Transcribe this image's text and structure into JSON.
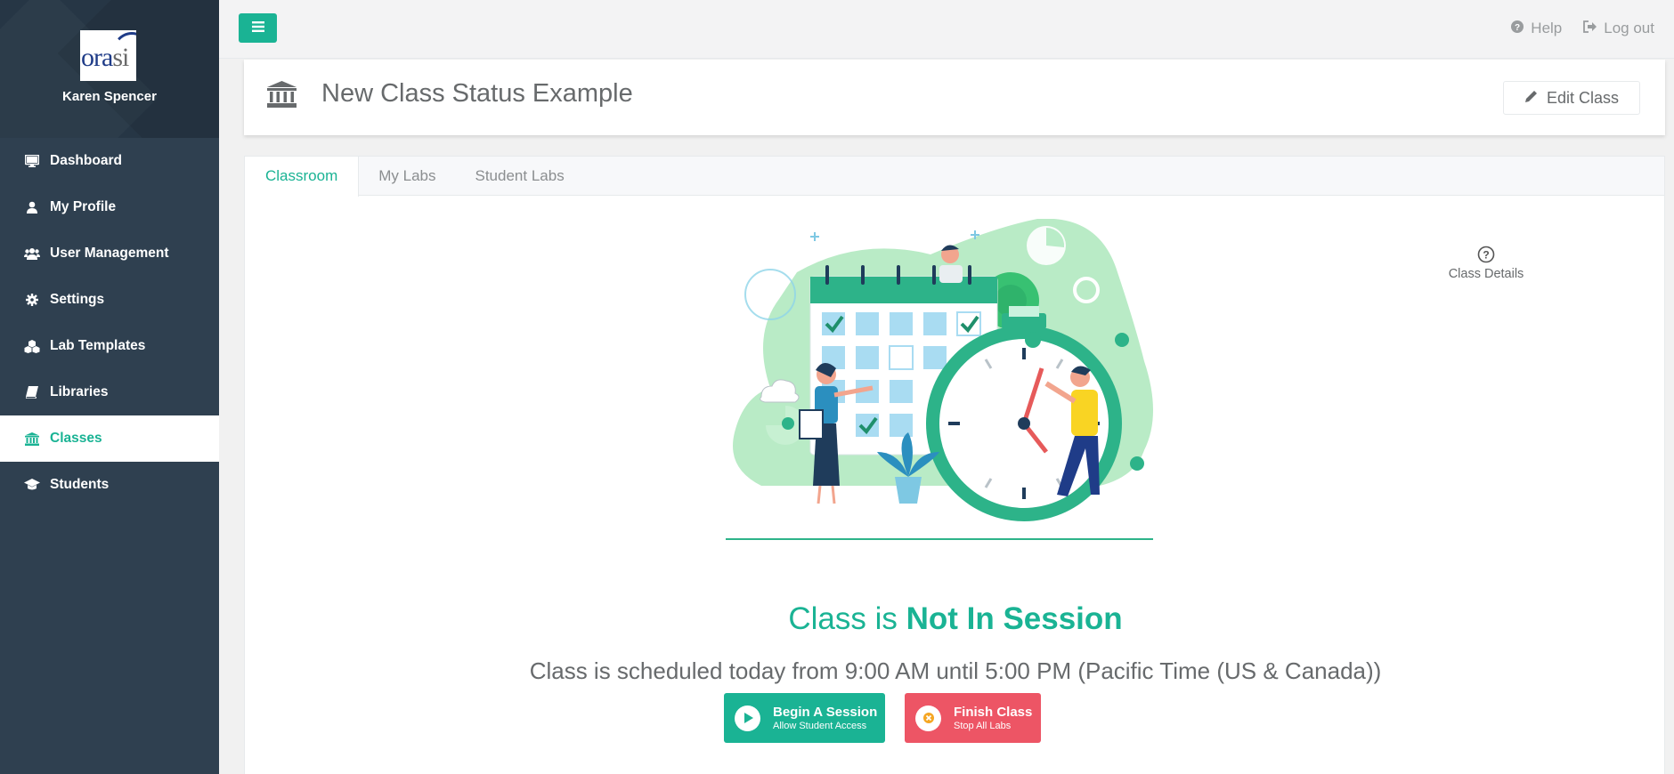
{
  "sidebar": {
    "user_name": "Karen Spencer",
    "items": [
      {
        "label": "Dashboard",
        "icon": "monitor-icon"
      },
      {
        "label": "My Profile",
        "icon": "user-icon"
      },
      {
        "label": "User Management",
        "icon": "users-icon"
      },
      {
        "label": "Settings",
        "icon": "gear-icon"
      },
      {
        "label": "Lab Templates",
        "icon": "cubes-icon"
      },
      {
        "label": "Libraries",
        "icon": "book-icon"
      },
      {
        "label": "Classes",
        "icon": "institution-icon",
        "active": true
      },
      {
        "label": "Students",
        "icon": "graduation-cap-icon"
      }
    ]
  },
  "topbar": {
    "help_label": "Help",
    "logout_label": "Log out"
  },
  "header": {
    "title": "New Class Status Example",
    "edit_label": "Edit Class"
  },
  "tabs": [
    {
      "label": "Classroom",
      "active": true
    },
    {
      "label": "My Labs"
    },
    {
      "label": "Student Labs"
    }
  ],
  "classroom": {
    "details_label": "Class Details",
    "status_prefix": "Class is ",
    "status_value": "Not In Session",
    "schedule_text": "Class is scheduled today from 9:00 AM until 5:00 PM (Pacific Time (US & Canada))",
    "begin_label": "Begin A Session",
    "begin_sub": "Allow Student Access",
    "finish_label": "Finish Class",
    "finish_sub": "Stop All Labs"
  },
  "colors": {
    "accent": "#1ab394",
    "sidebar": "#2f4050",
    "danger": "#ed5565"
  }
}
